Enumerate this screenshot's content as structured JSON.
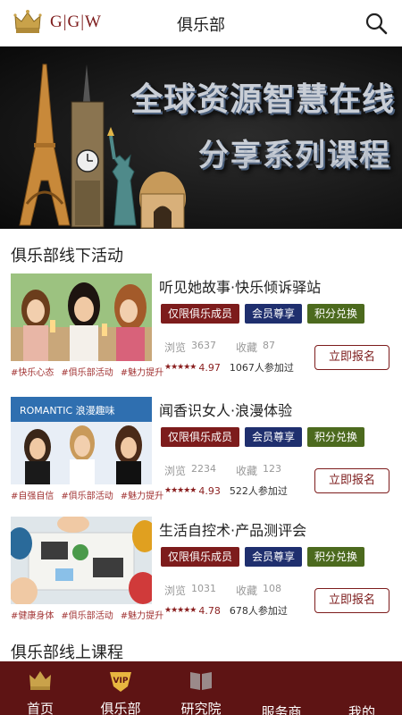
{
  "header": {
    "logo_text": "G|G|W",
    "title": "俱乐部"
  },
  "banner": {
    "line1": "全球资源智慧在线",
    "line2": "分享系列课程"
  },
  "sections": {
    "offline_title": "俱乐部线下活动",
    "online_title": "俱乐部线上课程"
  },
  "labels": {
    "views": "浏览",
    "favorites": "收藏",
    "signup": "立即报名",
    "participants_suffix": "人参加过"
  },
  "activities": [
    {
      "title": "听见她故事·快乐倾诉驿站",
      "badges": [
        "仅限俱乐成员",
        "会员尊享",
        "积分兑换"
      ],
      "views": "3637",
      "favorites": "87",
      "stars": "★★★★★",
      "score": "4.97",
      "participants": "1067",
      "tags": [
        "#快乐心态",
        "#俱乐部活动",
        "#魅力提升"
      ]
    },
    {
      "title": "闻香识女人·浪漫体验",
      "badges": [
        "仅限俱乐成员",
        "会员尊享",
        "积分兑换"
      ],
      "views": "2234",
      "favorites": "123",
      "stars": "★★★★★",
      "score": "4.93",
      "participants": "522",
      "tags": [
        "#自强自信",
        "#俱乐部活动",
        "#魅力提升"
      ],
      "image_text": "ROMANTIC 浪漫趣味"
    },
    {
      "title": "生活自控术·产品测评会",
      "badges": [
        "仅限俱乐成员",
        "会员尊享",
        "积分兑换"
      ],
      "views": "1031",
      "favorites": "108",
      "stars": "★★★★★",
      "score": "4.78",
      "participants": "678",
      "tags": [
        "#健康身体",
        "#俱乐部活动",
        "#魅力提升"
      ]
    }
  ],
  "nav": {
    "home": "首页",
    "club": "俱乐部",
    "vip_badge": "VIP",
    "research": "研究院",
    "service": "服务商",
    "mine": "我的"
  },
  "colors": {
    "brand": "#7d1c1c",
    "nav_bg": "#5e1414",
    "badge_blue": "#1f2f6e",
    "badge_green": "#4c6a1e"
  }
}
